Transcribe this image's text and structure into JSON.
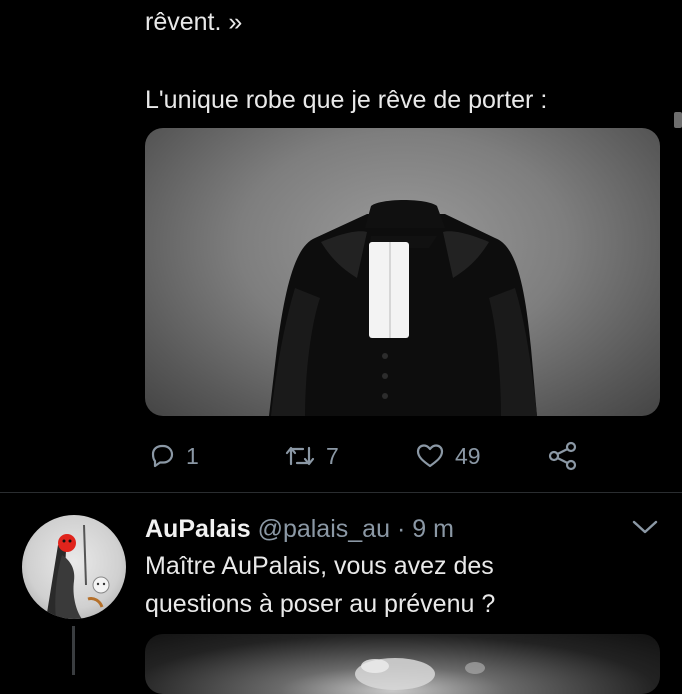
{
  "tweet1": {
    "text_line_top": "rêvent. »",
    "text_line_main": "L'unique robe que je rêve de porter :",
    "media_alt": "robe d'avocat",
    "actions": {
      "reply_count": "1",
      "retweet_count": "7",
      "like_count": "49"
    }
  },
  "tweet2": {
    "author_name": "AuPalais",
    "handle": "@palais_au",
    "separator": "·",
    "time": "9 m",
    "text_line1": "Maître AuPalais, vous avez des",
    "text_line2": "questions à poser au prévenu ?"
  },
  "colors": {
    "background": "#000000",
    "text": "#e9e9e9",
    "secondary": "#8b98a5",
    "divider": "#2a2d30"
  },
  "icons": [
    "reply-icon",
    "retweet-icon",
    "like-icon",
    "share-icon",
    "chevron-down-icon"
  ]
}
